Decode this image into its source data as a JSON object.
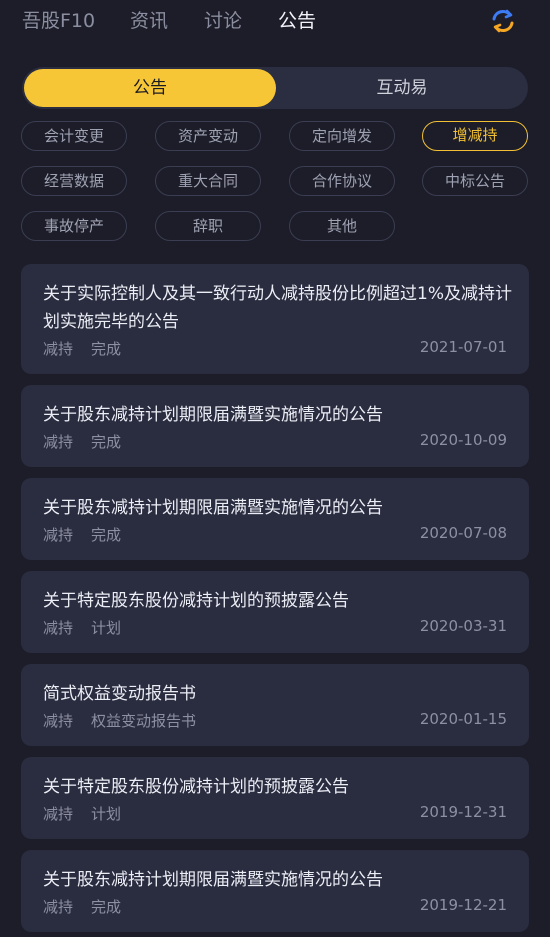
{
  "topnav": {
    "tabs": [
      "吾股F10",
      "资讯",
      "讨论",
      "公告"
    ],
    "active_index": 3,
    "refresh_icon": "refresh-icon"
  },
  "segment": {
    "options": [
      "公告",
      "互动易"
    ],
    "active_index": 0
  },
  "filters": {
    "chips": [
      "会计变更",
      "资产变动",
      "定向增发",
      "增减持",
      "经营数据",
      "重大合同",
      "合作协议",
      "中标公告",
      "事故停产",
      "辞职",
      "其他"
    ],
    "active_index": 3
  },
  "announcements": [
    {
      "title": "关于实际控制人及其一致行动人减持股份比例超过1%及减持计划实施完毕的公告",
      "tag1": "减持",
      "tag2": "完成",
      "date": "2021-07-01"
    },
    {
      "title": "关于股东减持计划期限届满暨实施情况的公告",
      "tag1": "减持",
      "tag2": "完成",
      "date": "2020-10-09"
    },
    {
      "title": "关于股东减持计划期限届满暨实施情况的公告",
      "tag1": "减持",
      "tag2": "完成",
      "date": "2020-07-08"
    },
    {
      "title": "关于特定股东股份减持计划的预披露公告",
      "tag1": "减持",
      "tag2": "计划",
      "date": "2020-03-31"
    },
    {
      "title": "简式权益变动报告书",
      "tag1": "减持",
      "tag2": "权益变动报告书",
      "date": "2020-01-15"
    },
    {
      "title": "关于特定股东股份减持计划的预披露公告",
      "tag1": "减持",
      "tag2": "计划",
      "date": "2019-12-31"
    },
    {
      "title": "关于股东减持计划期限届满暨实施情况的公告",
      "tag1": "减持",
      "tag2": "完成",
      "date": "2019-12-21"
    }
  ],
  "colors": {
    "background": "#1c1d29",
    "card": "#2a2c3f",
    "accent": "#f6c636",
    "refresh_blue": "#3d7bf5",
    "refresh_orange": "#f5a623"
  }
}
